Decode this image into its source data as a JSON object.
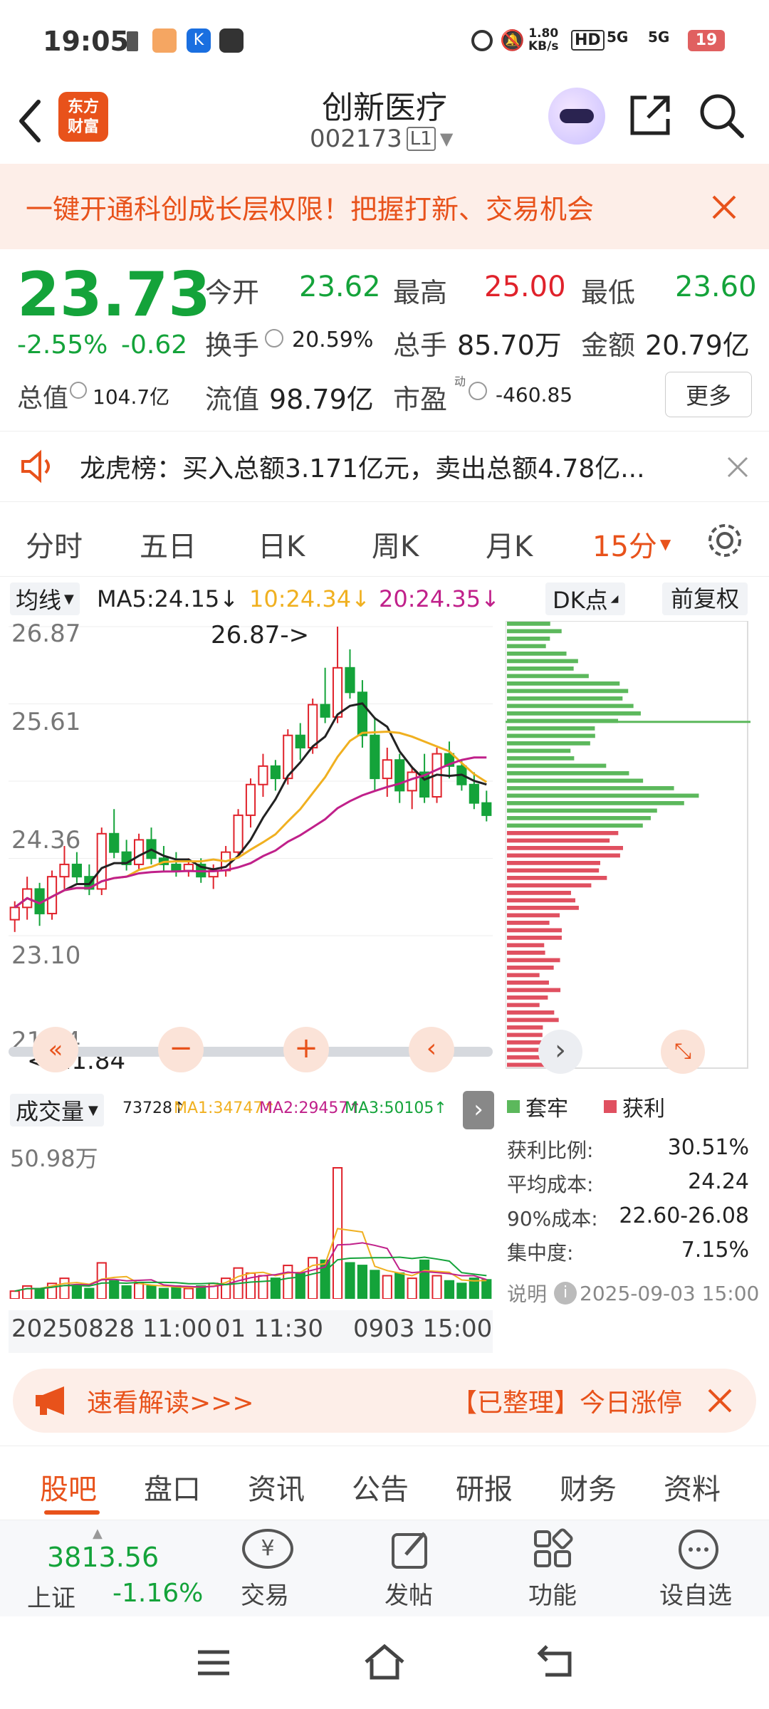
{
  "status": {
    "time": "19:05",
    "net_speed": "1.80",
    "net_unit": "KB/s",
    "battery": "19",
    "sig1": "5G",
    "sig2": "5G"
  },
  "header": {
    "logo_line1": "东方",
    "logo_line2": "财富",
    "title": "创新医疗",
    "code": "002173",
    "level": "L1"
  },
  "banner": {
    "text": "一键开通科创成长层权限！把握打新、交易机会"
  },
  "quote": {
    "price": "23.73",
    "change_pct": "-2.55%",
    "change": "-0.62",
    "open_label": "今开",
    "open": "23.62",
    "high_label": "最高",
    "high": "25.00",
    "low_label": "最低",
    "low": "23.60",
    "turnover_label": "换手",
    "turnover": "20.59%",
    "volume_label": "总手",
    "volume": "85.70万",
    "amount_label": "金额",
    "amount": "20.79亿",
    "mktcap_label": "总值",
    "mktcap": "104.7亿",
    "float_label": "流值",
    "float": "98.79亿",
    "pe_label": "市盈",
    "pe_sup": "动",
    "pe": "-460.85",
    "more": "更多"
  },
  "notice": {
    "text": "龙虎榜：买入总额3.171亿元，卖出总额4.78亿..."
  },
  "tabs": [
    "分时",
    "五日",
    "日K",
    "周K",
    "月K",
    "15分"
  ],
  "ma": {
    "selector": "均线",
    "ma5": "MA5:24.15↓",
    "ma10": "10:24.34↓",
    "ma20": "20:24.35↓",
    "dk": "DK点",
    "adjust": "前复权"
  },
  "price_axis": [
    "26.87",
    "25.61",
    "24.36",
    "23.10",
    "21.84"
  ],
  "annotations": {
    "high": "26.87->",
    "low": "<-21.84"
  },
  "volume": {
    "selector": "成交量",
    "val": "73728↑",
    "ma1": "MA1:34747↑",
    "ma2": "MA2:29457↑",
    "ma3": "MA3:50105↑",
    "max": "50.98万"
  },
  "time_axis": {
    "left": "20250828 11:00",
    "mid": "01 11:30",
    "right": "0903 15:00"
  },
  "chips": {
    "legend_trapped": "套牢",
    "legend_profit": "获利",
    "rows": [
      {
        "label": "获利比例:",
        "value": "30.51%"
      },
      {
        "label": "平均成本:",
        "value": "24.24"
      },
      {
        "label": "90%成本:",
        "value": "22.60-26.08"
      },
      {
        "label": "集中度:",
        "value": "7.15%"
      }
    ],
    "note_label": "说明",
    "note_time": "2025-09-03 15:00"
  },
  "promo": {
    "left": "速看解读>>>",
    "right": "【已整理】今日涨停"
  },
  "bottom_tabs": [
    "股吧",
    "盘口",
    "资讯",
    "公告",
    "研报",
    "财务",
    "资料"
  ],
  "dock": {
    "index_price": "3813.56",
    "index_name": "上证",
    "index_change": "-1.16%",
    "trade": "交易",
    "post": "发帖",
    "func": "功能",
    "watch": "设自选"
  },
  "colors": {
    "up": "#e0222b",
    "down": "#14a33a",
    "accent": "#e8521b",
    "ma5": "#222222",
    "ma10": "#f0b020",
    "ma20": "#c0208a"
  },
  "chart_data": {
    "type": "candlestick",
    "price_ylim": [
      21.84,
      26.87
    ],
    "candles": [
      [
        22.1,
        22.4,
        21.9,
        22.3
      ],
      [
        22.3,
        22.8,
        22.1,
        22.6
      ],
      [
        22.6,
        22.7,
        22.0,
        22.2
      ],
      [
        22.2,
        22.9,
        22.1,
        22.8
      ],
      [
        22.8,
        23.3,
        22.6,
        23.0
      ],
      [
        23.0,
        23.2,
        22.7,
        22.8
      ],
      [
        22.8,
        23.0,
        22.5,
        22.6
      ],
      [
        22.6,
        23.6,
        22.5,
        23.5
      ],
      [
        23.5,
        23.9,
        23.1,
        23.2
      ],
      [
        23.2,
        23.4,
        22.9,
        23.0
      ],
      [
        23.0,
        23.5,
        22.9,
        23.4
      ],
      [
        23.4,
        23.6,
        23.0,
        23.1
      ],
      [
        23.1,
        23.3,
        22.9,
        23.0
      ],
      [
        23.0,
        23.2,
        22.8,
        22.9
      ],
      [
        22.9,
        23.1,
        22.8,
        23.0
      ],
      [
        23.0,
        23.1,
        22.7,
        22.8
      ],
      [
        22.8,
        23.0,
        22.6,
        22.9
      ],
      [
        22.9,
        23.3,
        22.8,
        23.2
      ],
      [
        23.2,
        23.9,
        23.1,
        23.8
      ],
      [
        23.8,
        24.4,
        23.6,
        24.3
      ],
      [
        24.3,
        24.8,
        24.1,
        24.6
      ],
      [
        24.6,
        24.7,
        24.2,
        24.4
      ],
      [
        24.4,
        25.2,
        24.3,
        25.1
      ],
      [
        25.1,
        25.3,
        24.7,
        24.9
      ],
      [
        24.9,
        25.7,
        24.8,
        25.6
      ],
      [
        25.6,
        26.2,
        25.3,
        25.4
      ],
      [
        25.4,
        26.87,
        25.3,
        26.2
      ],
      [
        26.2,
        26.5,
        25.7,
        25.8
      ],
      [
        25.8,
        26.0,
        24.9,
        25.1
      ],
      [
        25.1,
        25.4,
        24.2,
        24.4
      ],
      [
        24.4,
        24.9,
        24.1,
        24.7
      ],
      [
        24.7,
        24.8,
        24.0,
        24.2
      ],
      [
        24.2,
        24.6,
        23.9,
        24.5
      ],
      [
        24.5,
        24.8,
        24.0,
        24.1
      ],
      [
        24.1,
        24.9,
        24.0,
        24.8
      ],
      [
        24.8,
        25.0,
        24.4,
        24.6
      ],
      [
        24.6,
        24.7,
        24.2,
        24.3
      ],
      [
        24.3,
        24.5,
        23.9,
        24.0
      ],
      [
        24.0,
        24.2,
        23.7,
        23.8
      ]
    ],
    "volume_ylim": [
      0,
      50.98
    ],
    "volumes": [
      3,
      5,
      4,
      6,
      8,
      5,
      4,
      14,
      7,
      5,
      6,
      5,
      4,
      5,
      4,
      5,
      6,
      8,
      12,
      10,
      9,
      8,
      13,
      10,
      16,
      15,
      50.98,
      14,
      13,
      11,
      9,
      10,
      8,
      15,
      9,
      7,
      6,
      8,
      7.4
    ],
    "chip_rows": 60
  }
}
